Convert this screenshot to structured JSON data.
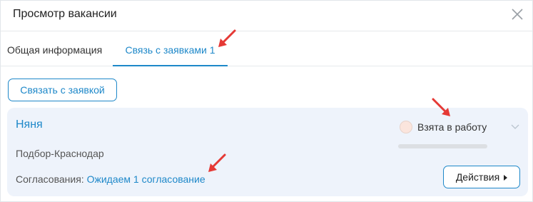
{
  "dialog": {
    "title": "Просмотр вакансии",
    "close_icon": "close-icon"
  },
  "tabs": [
    {
      "label": "Общая информация",
      "active": false
    },
    {
      "label": "Связь с заявками 1",
      "active": true
    }
  ],
  "link_button_label": "Связать с заявкой",
  "vacancy": {
    "title": "Няня",
    "subtitle": "Подбор-Краснодар",
    "approvals_label": "Согласования:",
    "approvals_value": "Ожидаем 1 согласование",
    "status": {
      "label": "Взята в работу",
      "progress": 0
    },
    "actions_label": "Действия"
  },
  "colors": {
    "accent": "#1e88c9",
    "card_background": "#eef3fb",
    "annotation_arrow": "#e53935"
  }
}
